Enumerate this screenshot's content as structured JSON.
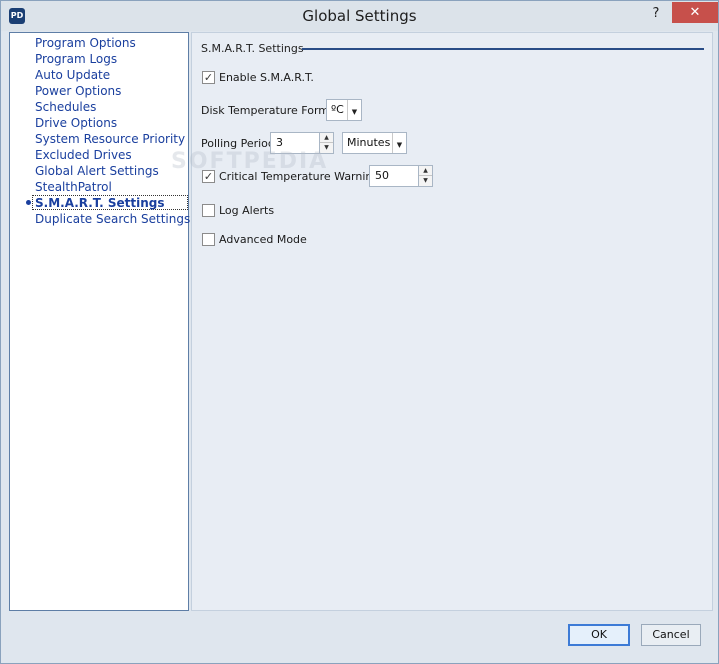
{
  "window": {
    "title": "Global Settings",
    "app_icon": "PD",
    "help_glyph": "?",
    "close_glyph": "✕"
  },
  "nav": {
    "items": [
      {
        "label": "Program Options"
      },
      {
        "label": "Program Logs"
      },
      {
        "label": "Auto Update"
      },
      {
        "label": "Power Options"
      },
      {
        "label": "Schedules"
      },
      {
        "label": "Drive Options"
      },
      {
        "label": "System Resource Priority"
      },
      {
        "label": "Excluded Drives"
      },
      {
        "label": "Global Alert Settings"
      },
      {
        "label": "StealthPatrol"
      },
      {
        "label": "S.M.A.R.T. Settings",
        "selected": true
      },
      {
        "label": "Duplicate Search Settings"
      }
    ]
  },
  "panel": {
    "section_title": "S.M.A.R.T. Settings",
    "enable_smart": {
      "label": "Enable S.M.A.R.T.",
      "checked": true,
      "mark": "✓"
    },
    "disk_temp_format": {
      "label": "Disk Temperature Format",
      "value": "ºC"
    },
    "polling_period": {
      "label": "Polling Period",
      "value": "3",
      "unit": "Minutes"
    },
    "critical_temp_warnings": {
      "label": "Critical Temperature Warnings",
      "checked": true,
      "mark": "✓",
      "value": "50"
    },
    "log_alerts": {
      "label": "Log Alerts",
      "checked": false
    },
    "advanced_mode": {
      "label": "Advanced Mode",
      "checked": false
    }
  },
  "watermark": "SOFTPEDIA",
  "footer": {
    "ok_label": "OK",
    "cancel_label": "Cancel"
  },
  "glyphs": {
    "up": "▲",
    "down": "▼"
  }
}
